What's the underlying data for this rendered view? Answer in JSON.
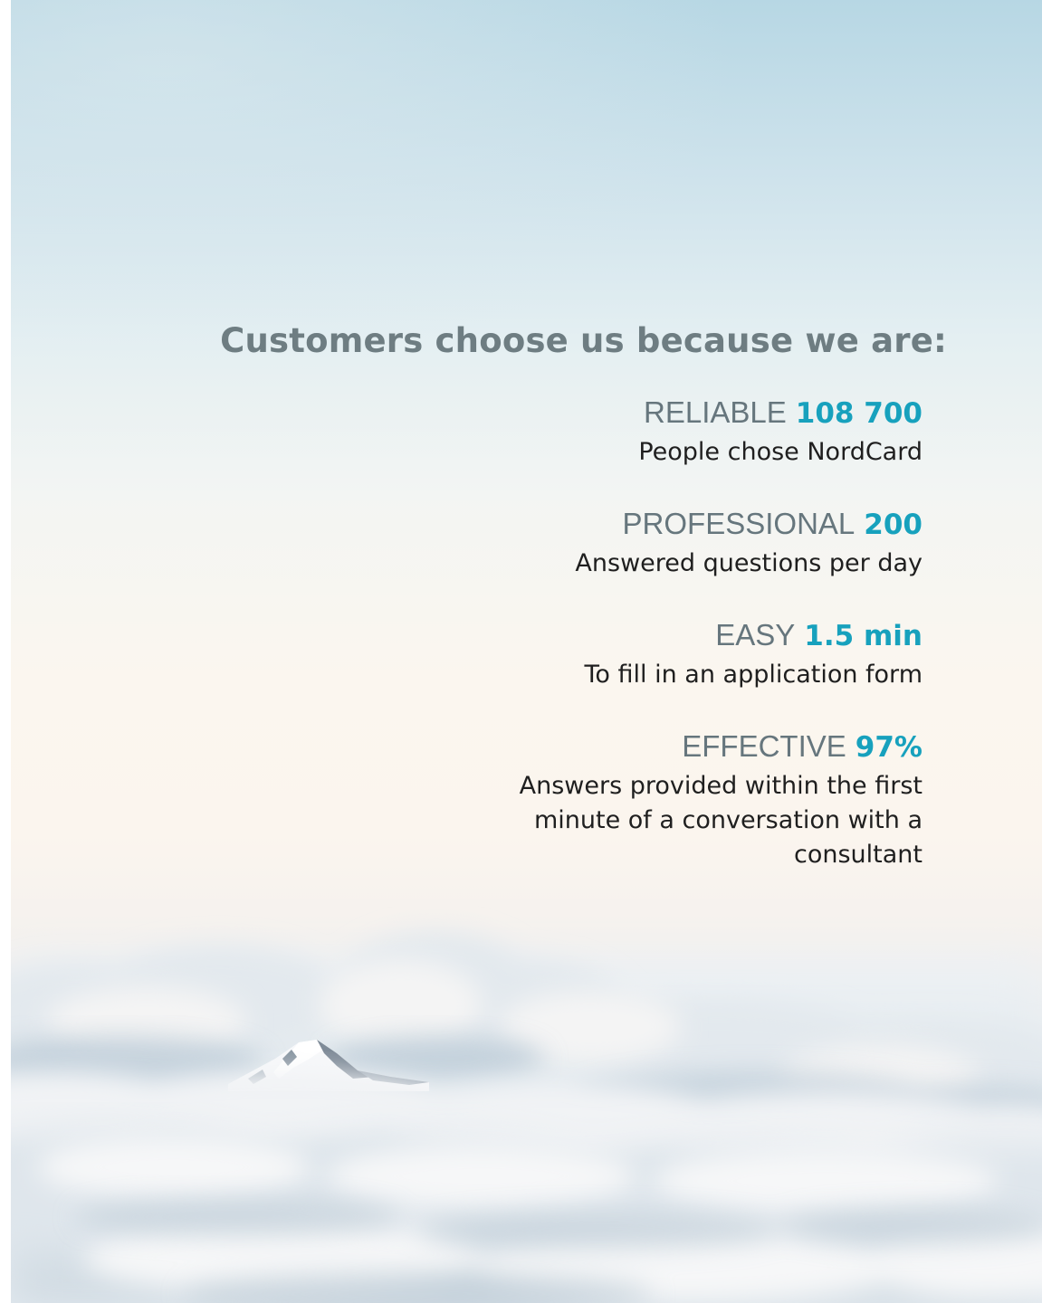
{
  "heading": "Customers choose us because we are:",
  "stats": [
    {
      "label": "RELIABLE",
      "value": "108 700",
      "description": "People chose NordCard"
    },
    {
      "label": "PROFESSIONAL",
      "value": "200",
      "description": "Answered questions per day"
    },
    {
      "label": "EASY",
      "value": "1.5 min",
      "description": "To fill in an application form"
    },
    {
      "label": "EFFECTIVE",
      "value": "97%",
      "description": "Answers provided within the first minute of a conversation with a consultant"
    }
  ],
  "colors": {
    "accent": "#17a1bd",
    "heading": "#6e7d82",
    "label": "#66767d",
    "text": "#1f1f1f"
  },
  "background": {
    "image": "clouds-with-mountain-peak"
  }
}
